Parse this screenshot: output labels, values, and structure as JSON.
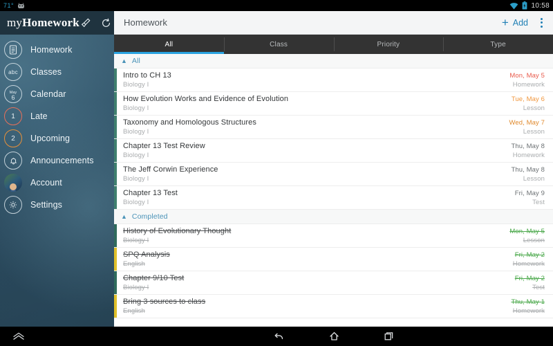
{
  "statusbar": {
    "temperature": "71°",
    "android_icon": "android-robot-icon",
    "wifi_icon": "wifi-icon",
    "battery_icon": "battery-icon",
    "time": "10:58"
  },
  "sidebar": {
    "brand_my": "my",
    "brand_homework": "Homework",
    "brush_icon": "paintbrush-icon",
    "sync_icon": "sync-refresh-icon",
    "items": [
      {
        "label": "Homework",
        "icon": "document-list-icon",
        "badge": ""
      },
      {
        "label": "Classes",
        "icon": "abc-icon",
        "badge": "abc"
      },
      {
        "label": "Calendar",
        "icon": "calendar-icon",
        "month": "May",
        "day": "6"
      },
      {
        "label": "Late",
        "icon": "late-count-icon",
        "badge": "1",
        "color": "#e8705a"
      },
      {
        "label": "Upcoming",
        "icon": "upcoming-count-icon",
        "badge": "2",
        "color": "#e8913a"
      },
      {
        "label": "Announcements",
        "icon": "bell-icon",
        "badge": ""
      },
      {
        "label": "Account",
        "icon": "avatar-icon",
        "badge": ""
      },
      {
        "label": "Settings",
        "icon": "gear-icon",
        "badge": ""
      }
    ]
  },
  "actionbar": {
    "title": "Homework",
    "add_label": "Add",
    "add_icon": "plus-icon",
    "overflow_icon": "overflow-menu-icon"
  },
  "tabs": [
    {
      "label": "All",
      "active": true
    },
    {
      "label": "Class",
      "active": false
    },
    {
      "label": "Priority",
      "active": false
    },
    {
      "label": "Type",
      "active": false
    }
  ],
  "sections": [
    {
      "title": "All",
      "chevron": "chevron-up-icon",
      "rows": [
        {
          "title": "Intro to CH 13",
          "class": "Biology I",
          "date": "Mon, May 5",
          "type": "Homework",
          "bar": "#3f7f6e",
          "date_color": "#e8594a",
          "done": false
        },
        {
          "title": "How Evolution Works and Evidence of Evolution",
          "class": "Biology I",
          "date": "Tue, May 6",
          "type": "Lesson",
          "bar": "#3f7f6e",
          "date_color": "#f0963c",
          "done": false
        },
        {
          "title": "Taxonomy and Homologous Structures",
          "class": "Biology I",
          "date": "Wed, May 7",
          "type": "Lesson",
          "bar": "#3f7f6e",
          "date_color": "#e08a2e",
          "done": false
        },
        {
          "title": "Chapter 13 Test Review",
          "class": "Biology I",
          "date": "Thu, May 8",
          "type": "Homework",
          "bar": "#3f7f6e",
          "date_color": "#6b7073",
          "done": false
        },
        {
          "title": "The Jeff Corwin Experience",
          "class": "Biology I",
          "date": "Thu, May 8",
          "type": "Lesson",
          "bar": "#3f7f6e",
          "date_color": "#6b7073",
          "done": false
        },
        {
          "title": "Chapter 13 Test",
          "class": "Biology I",
          "date": "Fri, May 9",
          "type": "Test",
          "bar": "#3f7f6e",
          "date_color": "#6b7073",
          "done": false
        }
      ]
    },
    {
      "title": "Completed",
      "chevron": "chevron-up-icon",
      "rows": [
        {
          "title": "History of Evolutionary Thought",
          "class": "Biology I",
          "date": "Mon, May 5",
          "type": "Lesson",
          "bar": "#2f6b5c",
          "date_color": "#4aa84a",
          "done": true
        },
        {
          "title": "SPQ Analysis",
          "class": "English",
          "date": "Fri, May 2",
          "type": "Homework",
          "bar": "#e0c02a",
          "date_color": "#4aa84a",
          "done": true
        },
        {
          "title": "Chapter 9/10 Test",
          "class": "Biology I",
          "date": "Fri, May 2",
          "type": "Test",
          "bar": "#2f6b5c",
          "date_color": "#4aa84a",
          "done": true
        },
        {
          "title": "Bring 3 sources to class",
          "class": "English",
          "date": "Thu, May 1",
          "type": "Homework",
          "bar": "#e0c02a",
          "date_color": "#4aa84a",
          "done": true
        }
      ]
    }
  ],
  "navbar": {
    "expand_icon": "chevron-up-double-icon",
    "back_icon": "back-arrow-icon",
    "home_icon": "home-icon",
    "recents_icon": "recent-apps-icon"
  },
  "colors": {
    "accent_blue": "#2aa3e0",
    "link_blue": "#1f7fb5",
    "tab_bg": "#333333",
    "sidebar_header": "#1f333f"
  }
}
